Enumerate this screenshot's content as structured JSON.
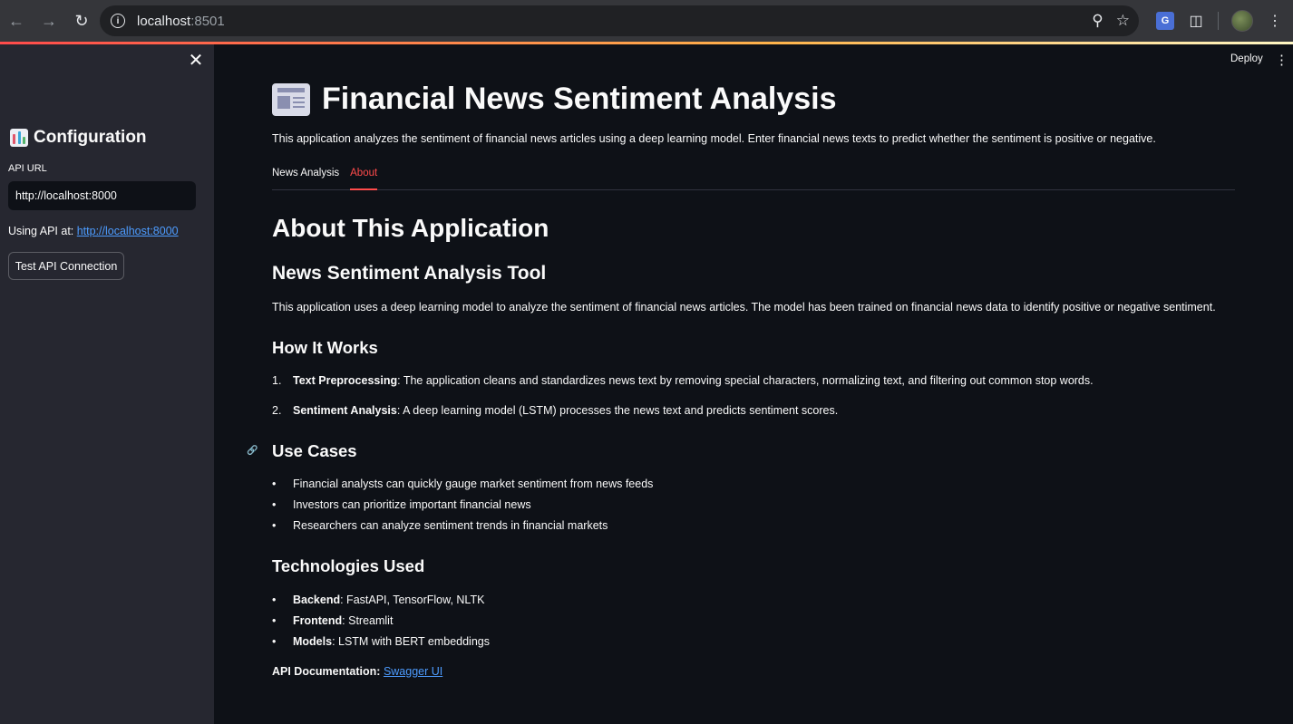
{
  "browser": {
    "url_host": "localhost",
    "url_port": ":8501"
  },
  "header": {
    "deploy_label": "Deploy"
  },
  "sidebar": {
    "title": "Configuration",
    "api_label": "API URL",
    "api_value": "http://localhost:8000",
    "using_prefix": "Using API at: ",
    "using_link": "http://localhost:8000",
    "test_button": "Test API Connection"
  },
  "main": {
    "title": "Financial News Sentiment Analysis",
    "intro": "This application analyzes the sentiment of financial news articles using a deep learning model. Enter financial news texts to predict whether the sentiment is positive or negative.",
    "tabs": [
      {
        "label": "News Analysis"
      },
      {
        "label": "About"
      }
    ],
    "about_heading": "About This Application",
    "tool_heading": "News Sentiment Analysis Tool",
    "tool_text": "This application uses a deep learning model to analyze the sentiment of financial news articles. The model has been trained on financial news data to identify positive or negative sentiment.",
    "how_heading": "How It Works",
    "steps": [
      {
        "num": "1.",
        "bold": "Text Preprocessing",
        "text": ": The application cleans and standardizes news text by removing special characters, normalizing text, and filtering out common stop words."
      },
      {
        "num": "2.",
        "bold": "Sentiment Analysis",
        "text": ": A deep learning model (LSTM) processes the news text and predicts sentiment scores."
      }
    ],
    "use_heading": "Use Cases",
    "use_cases": [
      "Financial analysts can quickly gauge market sentiment from news feeds",
      "Investors can prioritize important financial news",
      "Researchers can analyze sentiment trends in financial markets"
    ],
    "tech_heading": "Technologies Used",
    "tech": [
      {
        "bold": "Backend",
        "text": ": FastAPI, TensorFlow, NLTK"
      },
      {
        "bold": "Frontend",
        "text": ": Streamlit"
      },
      {
        "bold": "Models",
        "text": ": LSTM with BERT embeddings"
      }
    ],
    "api_doc_label": "API Documentation:",
    "api_doc_link": "Swagger UI"
  },
  "colors": {
    "accent": "#ff4b4b",
    "link": "#4d9cff",
    "sidebar_bg": "#262730",
    "main_bg": "#0e1117"
  }
}
